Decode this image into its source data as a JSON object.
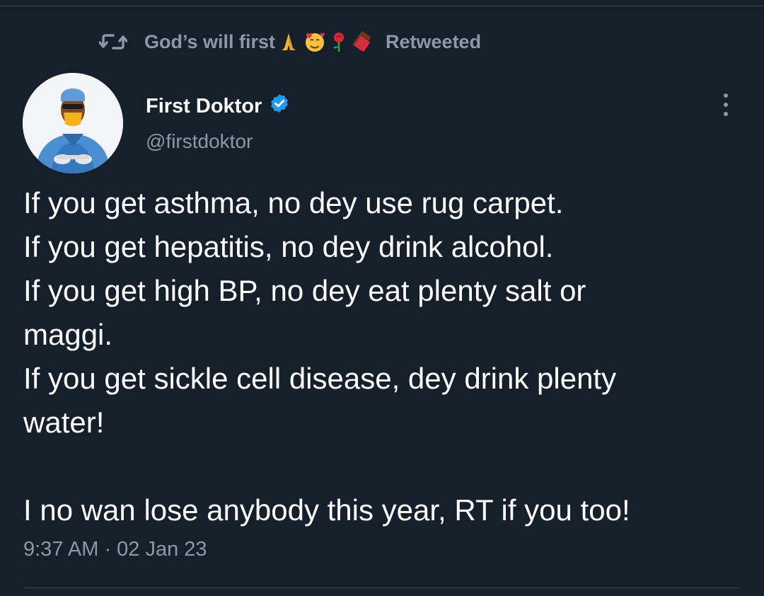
{
  "retweet": {
    "user": "God’s will first",
    "emojis": [
      "praying-hands-emoji",
      "smiling-face-hearts-emoji",
      "rose-emoji",
      "chocolate-bar-emoji"
    ],
    "label": "Retweeted"
  },
  "author": {
    "name": "First Doktor",
    "handle": "@firstdoktor",
    "verified": true
  },
  "tweet": {
    "lines": [
      "If you get asthma, no dey use rug carpet.",
      "If you get hepatitis, no dey drink alcohol.",
      "If you get high BP, no dey eat plenty salt or",
      "maggi.",
      "If you get sickle cell disease, dey drink plenty",
      "water!",
      "",
      "I no wan lose anybody this year, RT if you too!"
    ],
    "timestamp": "9:37 AM · 02 Jan 23"
  },
  "colors": {
    "background": "#15202b",
    "text": "#ffffff",
    "secondary": "#8b98a5",
    "verified": "#1d9bf0",
    "divider": "#38444d"
  }
}
